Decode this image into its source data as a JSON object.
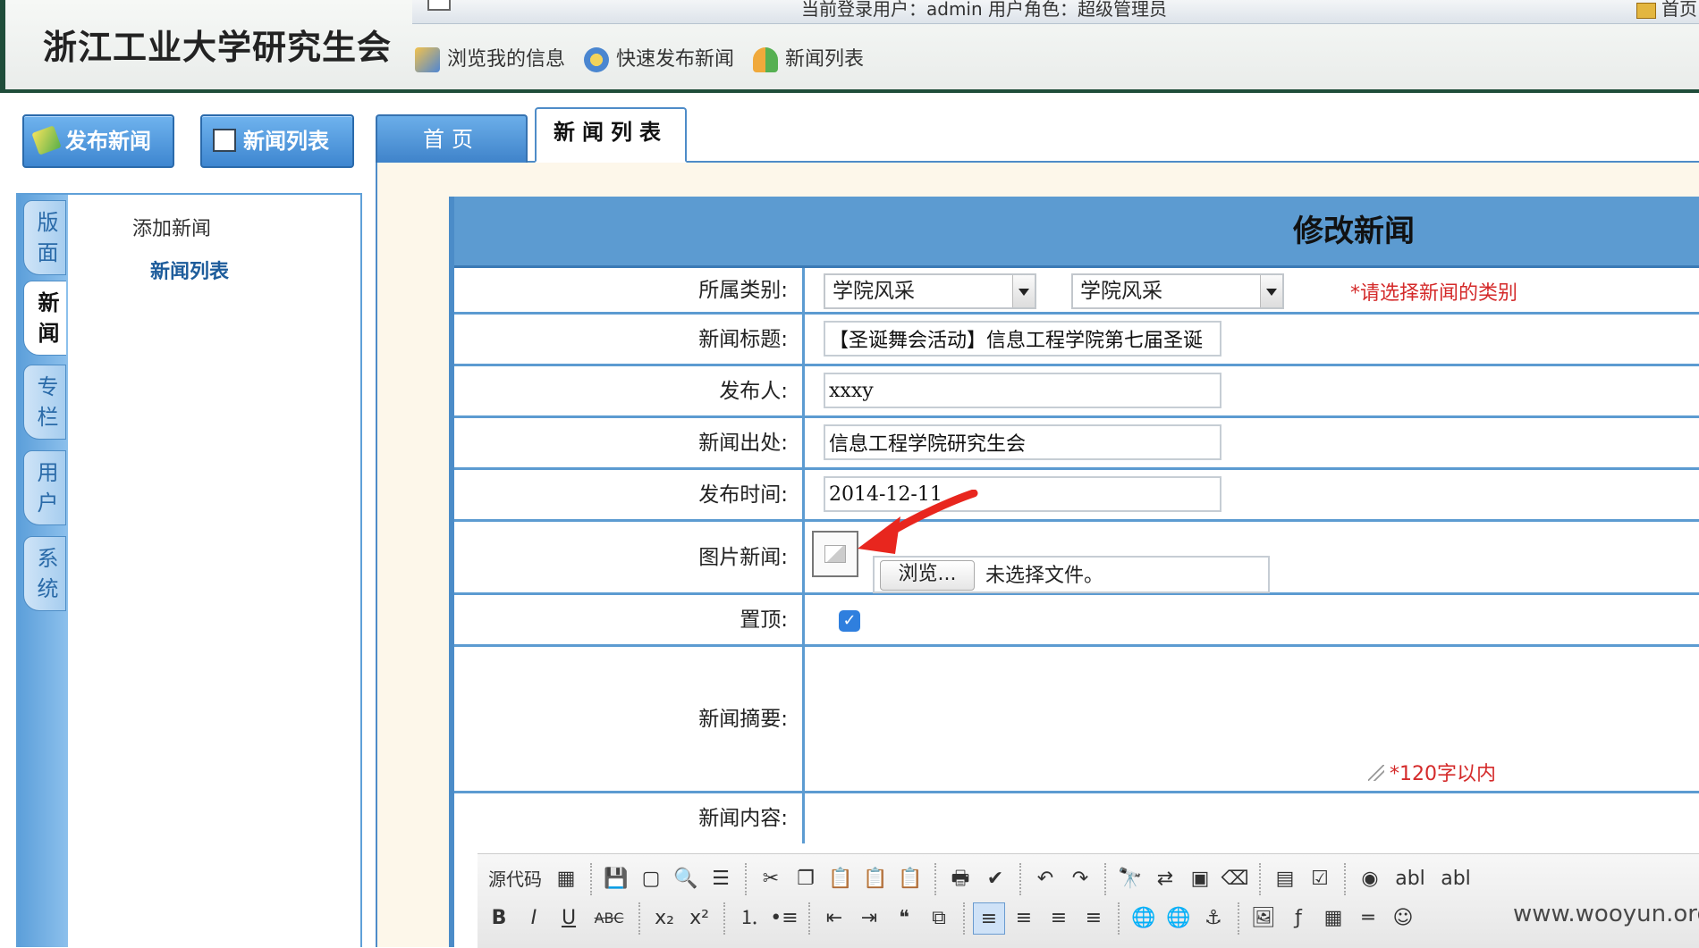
{
  "header": {
    "site_title": "浙江工业大学研究生会",
    "status_text": "当前登录用户：admin   用户角色：超级管理员",
    "home_text": "首页",
    "quick_links": [
      {
        "label": "浏览我的信息",
        "icon": "info-icon"
      },
      {
        "label": "快速发布新闻",
        "icon": "gear-icon"
      },
      {
        "label": "新闻列表",
        "icon": "people-icon"
      }
    ]
  },
  "sidebar": {
    "buttons": [
      {
        "label": "发布新闻",
        "icon": "pencil-icon"
      },
      {
        "label": "新闻列表",
        "icon": "list-icon"
      }
    ],
    "vtabs": [
      {
        "label": "版面",
        "active": false
      },
      {
        "label": "新闻",
        "active": true
      },
      {
        "label": "专栏",
        "active": false
      },
      {
        "label": "用户",
        "active": false
      },
      {
        "label": "系统",
        "active": false
      }
    ],
    "tree": {
      "add_news": "添加新闻",
      "news_list": "新闻列表"
    }
  },
  "tabs": [
    {
      "label": "首页",
      "active": false
    },
    {
      "label": "新闻列表",
      "active": true
    }
  ],
  "form": {
    "title": "修改新闻",
    "category": {
      "label": "所属类别:",
      "select1": "学院风采",
      "select2": "学院风采",
      "hint": "*请选择新闻的类别"
    },
    "news_title": {
      "label": "新闻标题:",
      "value": "【圣诞舞会活动】信息工程学院第七届圣诞"
    },
    "publisher": {
      "label": "发布人:",
      "value": "xxxy"
    },
    "source": {
      "label": "新闻出处:",
      "value": "信息工程学院研究生会"
    },
    "publish_time": {
      "label": "发布时间:",
      "value": "2014-12-11"
    },
    "image_news": {
      "label": "图片新闻:",
      "browse_label": "浏览...",
      "file_status": "未选择文件。"
    },
    "pin_top": {
      "label": "置顶:",
      "checked": true
    },
    "summary": {
      "label": "新闻摘要:",
      "hint": "*120字以内"
    },
    "content": {
      "label": "新闻内容:"
    }
  },
  "editor_toolbar": {
    "row1": [
      {
        "name": "source-button",
        "label": "源代码"
      },
      {
        "name": "paste-text-button",
        "label": "▦"
      },
      {
        "name": "save-button",
        "label": "💾"
      },
      {
        "name": "new-page-button",
        "label": "▢"
      },
      {
        "name": "preview-button",
        "label": "🔍"
      },
      {
        "name": "templates-button",
        "label": "☰"
      },
      {
        "name": "cut-button",
        "label": "✂"
      },
      {
        "name": "copy-button",
        "label": "❐"
      },
      {
        "name": "paste-button",
        "label": "📋"
      },
      {
        "name": "paste-plain-button",
        "label": "📋"
      },
      {
        "name": "paste-word-button",
        "label": "📋"
      },
      {
        "name": "print-button",
        "label": "🖶"
      },
      {
        "name": "spellcheck-button",
        "label": "✔"
      },
      {
        "name": "undo-button",
        "label": "↶"
      },
      {
        "name": "redo-button",
        "label": "↷"
      },
      {
        "name": "find-button",
        "label": "🔭"
      },
      {
        "name": "replace-button",
        "label": "⇄"
      },
      {
        "name": "select-all-button",
        "label": "▣"
      },
      {
        "name": "remove-format-button",
        "label": "⌫"
      },
      {
        "name": "form-button",
        "label": "▤"
      },
      {
        "name": "checkbox-button",
        "label": "☑"
      },
      {
        "name": "radio-button",
        "label": "◉"
      },
      {
        "name": "textfield-button",
        "label": "abl"
      },
      {
        "name": "textarea-button",
        "label": "abl"
      }
    ],
    "row2": [
      {
        "name": "bold-button",
        "label": "B"
      },
      {
        "name": "italic-button",
        "label": "I"
      },
      {
        "name": "underline-button",
        "label": "U"
      },
      {
        "name": "strike-button",
        "label": "ABC"
      },
      {
        "name": "subscript-button",
        "label": "x₂"
      },
      {
        "name": "superscript-button",
        "label": "x²"
      },
      {
        "name": "ordered-list-button",
        "label": "⒈"
      },
      {
        "name": "bullet-list-button",
        "label": "•≡"
      },
      {
        "name": "outdent-button",
        "label": "⇤"
      },
      {
        "name": "indent-button",
        "label": "⇥"
      },
      {
        "name": "blockquote-button",
        "label": "❝"
      },
      {
        "name": "div-button",
        "label": "⧉"
      },
      {
        "name": "align-left-button",
        "label": "≡",
        "active": true
      },
      {
        "name": "align-center-button",
        "label": "≡"
      },
      {
        "name": "align-right-button",
        "label": "≡"
      },
      {
        "name": "justify-button",
        "label": "≡"
      },
      {
        "name": "link-button",
        "label": "🌐"
      },
      {
        "name": "unlink-button",
        "label": "🌐"
      },
      {
        "name": "anchor-button",
        "label": "⚓"
      },
      {
        "name": "image-button",
        "label": "🖼"
      },
      {
        "name": "flash-button",
        "label": "ƒ"
      },
      {
        "name": "table-button",
        "label": "▦"
      },
      {
        "name": "hr-button",
        "label": "═"
      },
      {
        "name": "smiley-button",
        "label": "☺"
      }
    ]
  },
  "watermark": "www.wooyun.org"
}
